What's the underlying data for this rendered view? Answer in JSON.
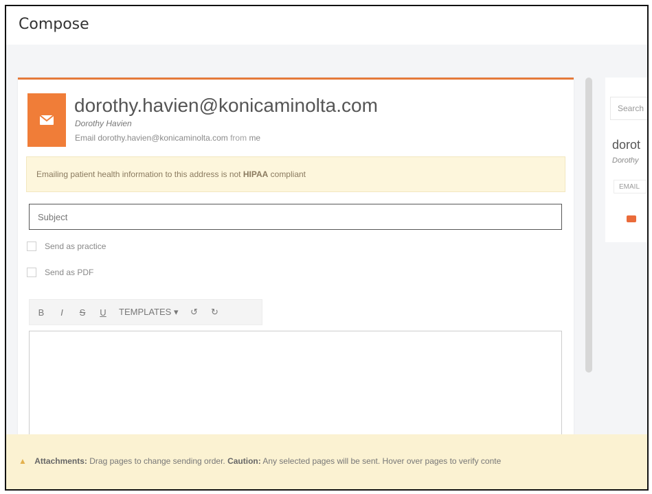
{
  "header": {
    "title": "Compose"
  },
  "contact": {
    "email": "dorothy.havien@konicaminolta.com",
    "name": "Dorothy Havien",
    "meta_prefix": "Email",
    "meta_email": "dorothy.havien@konicaminolta.com",
    "meta_from": "from",
    "meta_me": "me"
  },
  "warning": {
    "prefix": "Emailing patient health information to this address is not",
    "bold": "HIPAA",
    "suffix": "compliant"
  },
  "subject": {
    "placeholder": "Subject"
  },
  "options": {
    "send_as_practice": "Send as practice",
    "send_as_pdf": "Send as PDF"
  },
  "toolbar": {
    "bold": "B",
    "italic": "I",
    "strike": "S",
    "underline": "U",
    "templates": "TEMPLATES ▾",
    "undo": "↺",
    "redo": "↻"
  },
  "side": {
    "search": "Search",
    "name": "dorot",
    "sub": "Dorothy",
    "badge": "EMAIL"
  },
  "attachments": {
    "label": "Attachments:",
    "text1": "Drag pages to change sending order.",
    "label2": "Caution:",
    "text2": "Any selected pages will be sent. Hover over pages to verify conte"
  }
}
